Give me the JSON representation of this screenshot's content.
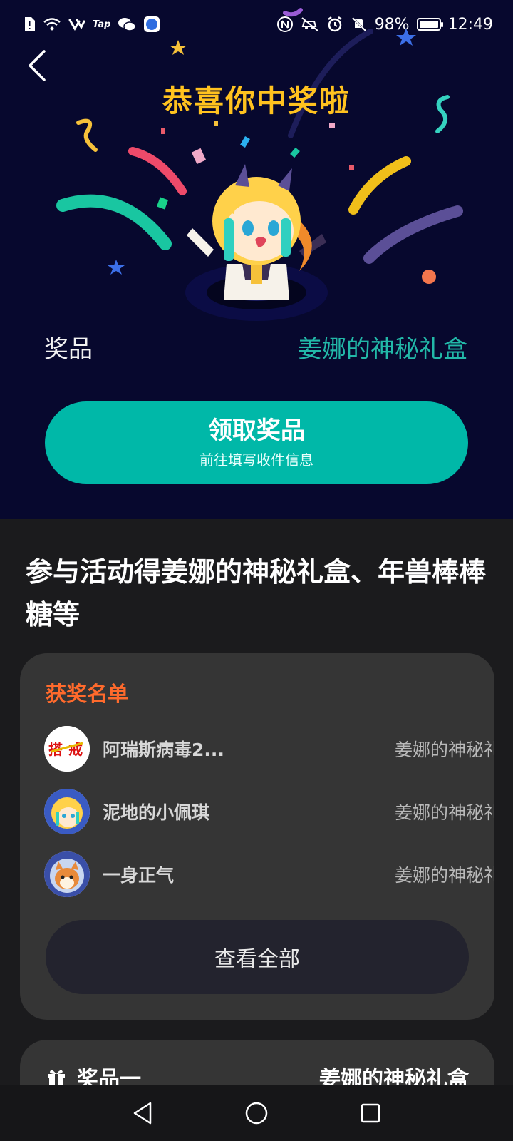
{
  "status_bar": {
    "battery": "98%",
    "time": "12:49",
    "tap_label": "Tap"
  },
  "hero": {
    "headline": "恭喜你中奖啦",
    "prize_label": "奖品",
    "prize_name": "姜娜的神秘礼盒",
    "claim_button": {
      "title": "领取奖品",
      "subtitle": "前往填写收件信息"
    }
  },
  "activity_title": "参与活动得姜娜的神秘礼盒、年兽棒棒糖等",
  "winners": {
    "title": "获奖名单",
    "rows": [
      {
        "name": "阿瑞斯病毒2...",
        "prize": "姜娜的神秘礼盒"
      },
      {
        "name": "泥地的小佩琪",
        "prize": "姜娜的神秘礼盒"
      },
      {
        "name": "一身正气",
        "prize": "姜娜的神秘礼盒"
      }
    ],
    "view_all": "查看全部"
  },
  "prize_card": {
    "label": "奖品一",
    "value": "姜娜的神秘礼盒"
  },
  "colors": {
    "hero_bg": "#07082e",
    "headline": "#ffc21f",
    "accent_teal": "#00b8a8",
    "winners_title": "#ff6a2c",
    "page_bg": "#1b1b1d",
    "card_bg": "#353535"
  }
}
